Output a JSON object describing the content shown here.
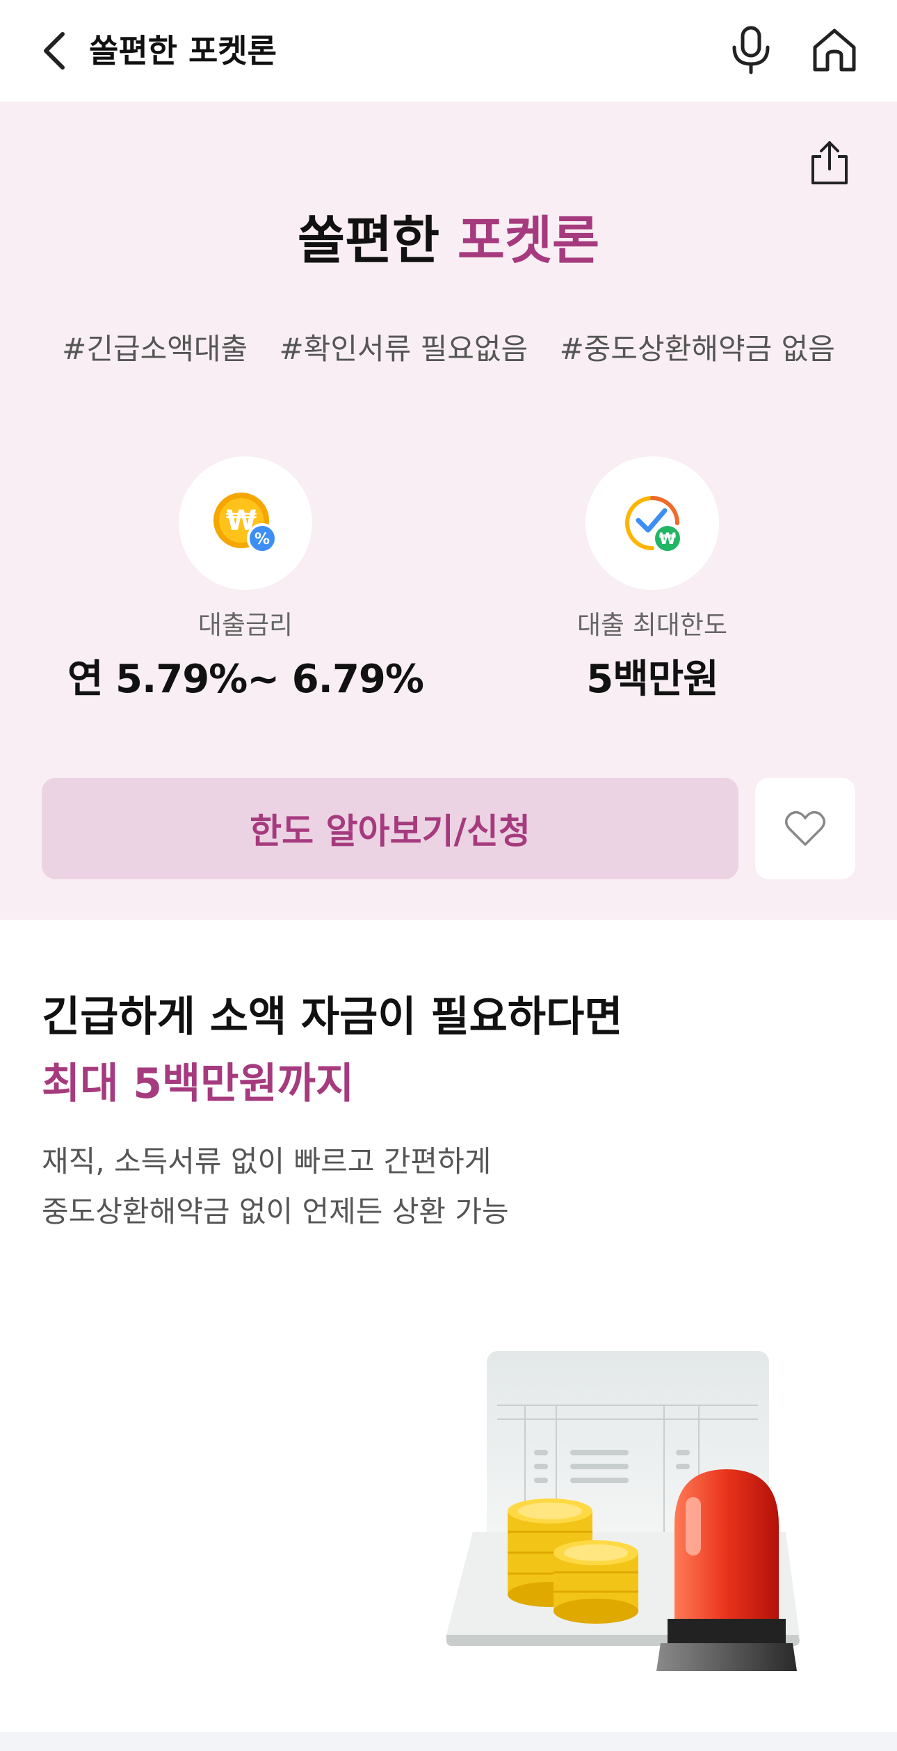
{
  "header": {
    "title": "쏠편한 포켓론",
    "back_icon": "chevron-left-icon",
    "mic_icon": "microphone-icon",
    "home_icon": "home-icon"
  },
  "hero": {
    "share_icon": "share-icon",
    "title_main": "쏠편한 ",
    "title_accent": "포켓론",
    "tags": [
      "#긴급소액대출",
      "#확인서류 필요없음",
      "#중도상환해약금 없음"
    ],
    "rate": {
      "label": "대출금리",
      "value": "연 5.79%~ 6.79%",
      "icon": "won-percent-coin-icon"
    },
    "limit": {
      "label": "대출 최대한도",
      "value": "5백만원",
      "icon": "won-check-gauge-icon"
    },
    "apply_label": "한도 알아보기/신청",
    "favorite_icon": "heart-icon"
  },
  "section": {
    "title_line1": "긴급하게 소액 자금이 필요하다면",
    "title_line2": "최대 5백만원까지",
    "desc_line1": "재직, 소득서류 없이 빠르고 간편하게",
    "desc_line2": "중도상환해약금 없이 언제든 상환 가능",
    "illustration": "coins-alarm-document-illustration"
  },
  "colors": {
    "accent": "#a63a7e",
    "hero_bg": "#f8eef3",
    "button_bg": "#ecd3e3"
  }
}
